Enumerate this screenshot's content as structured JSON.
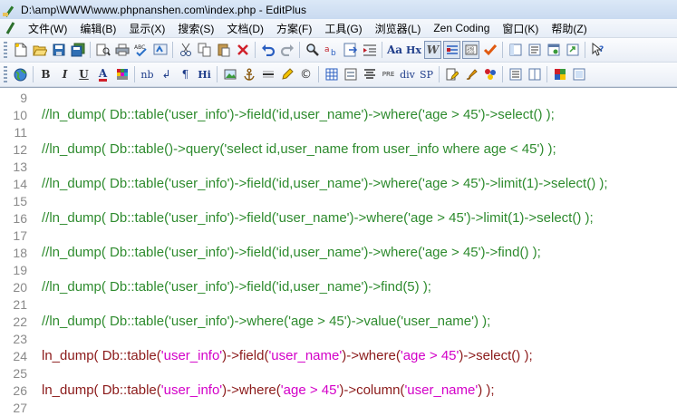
{
  "window": {
    "title": "D:\\amp\\WWW\\www.phpnanshen.com\\index.php - EditPlus"
  },
  "menu": [
    "文件(W)",
    "编辑(B)",
    "显示(X)",
    "搜索(S)",
    "文档(D)",
    "方案(F)",
    "工具(G)",
    "浏览器(L)",
    "Zen Coding",
    "窗口(K)",
    "帮助(Z)"
  ],
  "toolbar1": {
    "icons": [
      "new-file-icon",
      "open-folder-icon",
      "save-icon",
      "save-all-icon",
      "print-preview-icon",
      "print-icon",
      "spell-check-icon",
      "ftp-icon",
      "cut-icon",
      "copy-icon",
      "paste-icon",
      "delete-icon",
      "undo-icon",
      "redo-icon",
      "find-icon",
      "replace-icon",
      "goto-icon",
      "indent-icon",
      "font-size-icon",
      "hex-icon",
      "word-wrap-icon",
      "line-number-icon",
      "ruler-icon",
      "check-icon",
      "panel-icon",
      "cliptext-icon",
      "browser-icon",
      "window-icon",
      "help-icon"
    ],
    "text_buttons": {
      "font": "Aa",
      "hex": "Hx",
      "wrap": "W"
    }
  },
  "toolbar2": {
    "text_buttons": {
      "bold": "B",
      "italic": "I",
      "underline": "U",
      "font_color": "A",
      "nbsp": "nb",
      "br": "↲",
      "para": "¶",
      "heading": "Hi",
      "pre": "PRE",
      "div": "div",
      "span": "SP"
    }
  },
  "editor": {
    "lines": [
      {
        "no": "9",
        "segments": []
      },
      {
        "no": "10",
        "segments": [
          {
            "t": "//ln_dump( Db::table('user_info')->field('id,user_name')->where('age > 45')->select() );",
            "k": "comment"
          }
        ]
      },
      {
        "no": "11",
        "segments": []
      },
      {
        "no": "12",
        "segments": [
          {
            "t": "//ln_dump( Db::table()->query('select id,user_name from user_info where age < 45') );",
            "k": "comment"
          }
        ]
      },
      {
        "no": "13",
        "segments": []
      },
      {
        "no": "14",
        "segments": [
          {
            "t": "//ln_dump( Db::table('user_info')->field('id,user_name')->where('age > 45')->limit(1)->select() );",
            "k": "comment"
          }
        ]
      },
      {
        "no": "15",
        "segments": []
      },
      {
        "no": "16",
        "segments": [
          {
            "t": "//ln_dump( Db::table('user_info')->field('user_name')->where('age > 45')->limit(1)->select() );",
            "k": "comment"
          }
        ]
      },
      {
        "no": "17",
        "segments": []
      },
      {
        "no": "18",
        "segments": [
          {
            "t": "//ln_dump( Db::table('user_info')->field('id,user_name')->where('age > 45')->find() );",
            "k": "comment"
          }
        ]
      },
      {
        "no": "19",
        "segments": []
      },
      {
        "no": "20",
        "segments": [
          {
            "t": "//ln_dump( Db::table('user_info')->field('id,user_name')->find(5) );",
            "k": "comment"
          }
        ]
      },
      {
        "no": "21",
        "segments": []
      },
      {
        "no": "22",
        "segments": [
          {
            "t": "//ln_dump( Db::table('user_info')->where('age > 45')->value('user_name') );",
            "k": "comment"
          }
        ]
      },
      {
        "no": "23",
        "segments": []
      },
      {
        "no": "24",
        "segments": [
          {
            "t": "ln_dump( Db::table(",
            "k": "code"
          },
          {
            "t": "'user_info'",
            "k": "string"
          },
          {
            "t": ")->field(",
            "k": "code"
          },
          {
            "t": "'user_name'",
            "k": "string"
          },
          {
            "t": ")->where(",
            "k": "code"
          },
          {
            "t": "'age > 45'",
            "k": "string"
          },
          {
            "t": ")->select() );",
            "k": "code"
          }
        ]
      },
      {
        "no": "25",
        "segments": []
      },
      {
        "no": "26",
        "segments": [
          {
            "t": "ln_dump( Db::table(",
            "k": "code"
          },
          {
            "t": "'user_info'",
            "k": "string"
          },
          {
            "t": ")->where(",
            "k": "code"
          },
          {
            "t": "'age > 45'",
            "k": "string"
          },
          {
            "t": ")->column(",
            "k": "code"
          },
          {
            "t": "'user_name'",
            "k": "string"
          },
          {
            "t": ") );",
            "k": "code"
          }
        ]
      },
      {
        "no": "27",
        "segments": []
      }
    ]
  },
  "colors": {
    "comment": "#2e8b2e",
    "code": "#8b1a1a",
    "string": "#d300c8",
    "line_number": "#8a8a8a"
  }
}
